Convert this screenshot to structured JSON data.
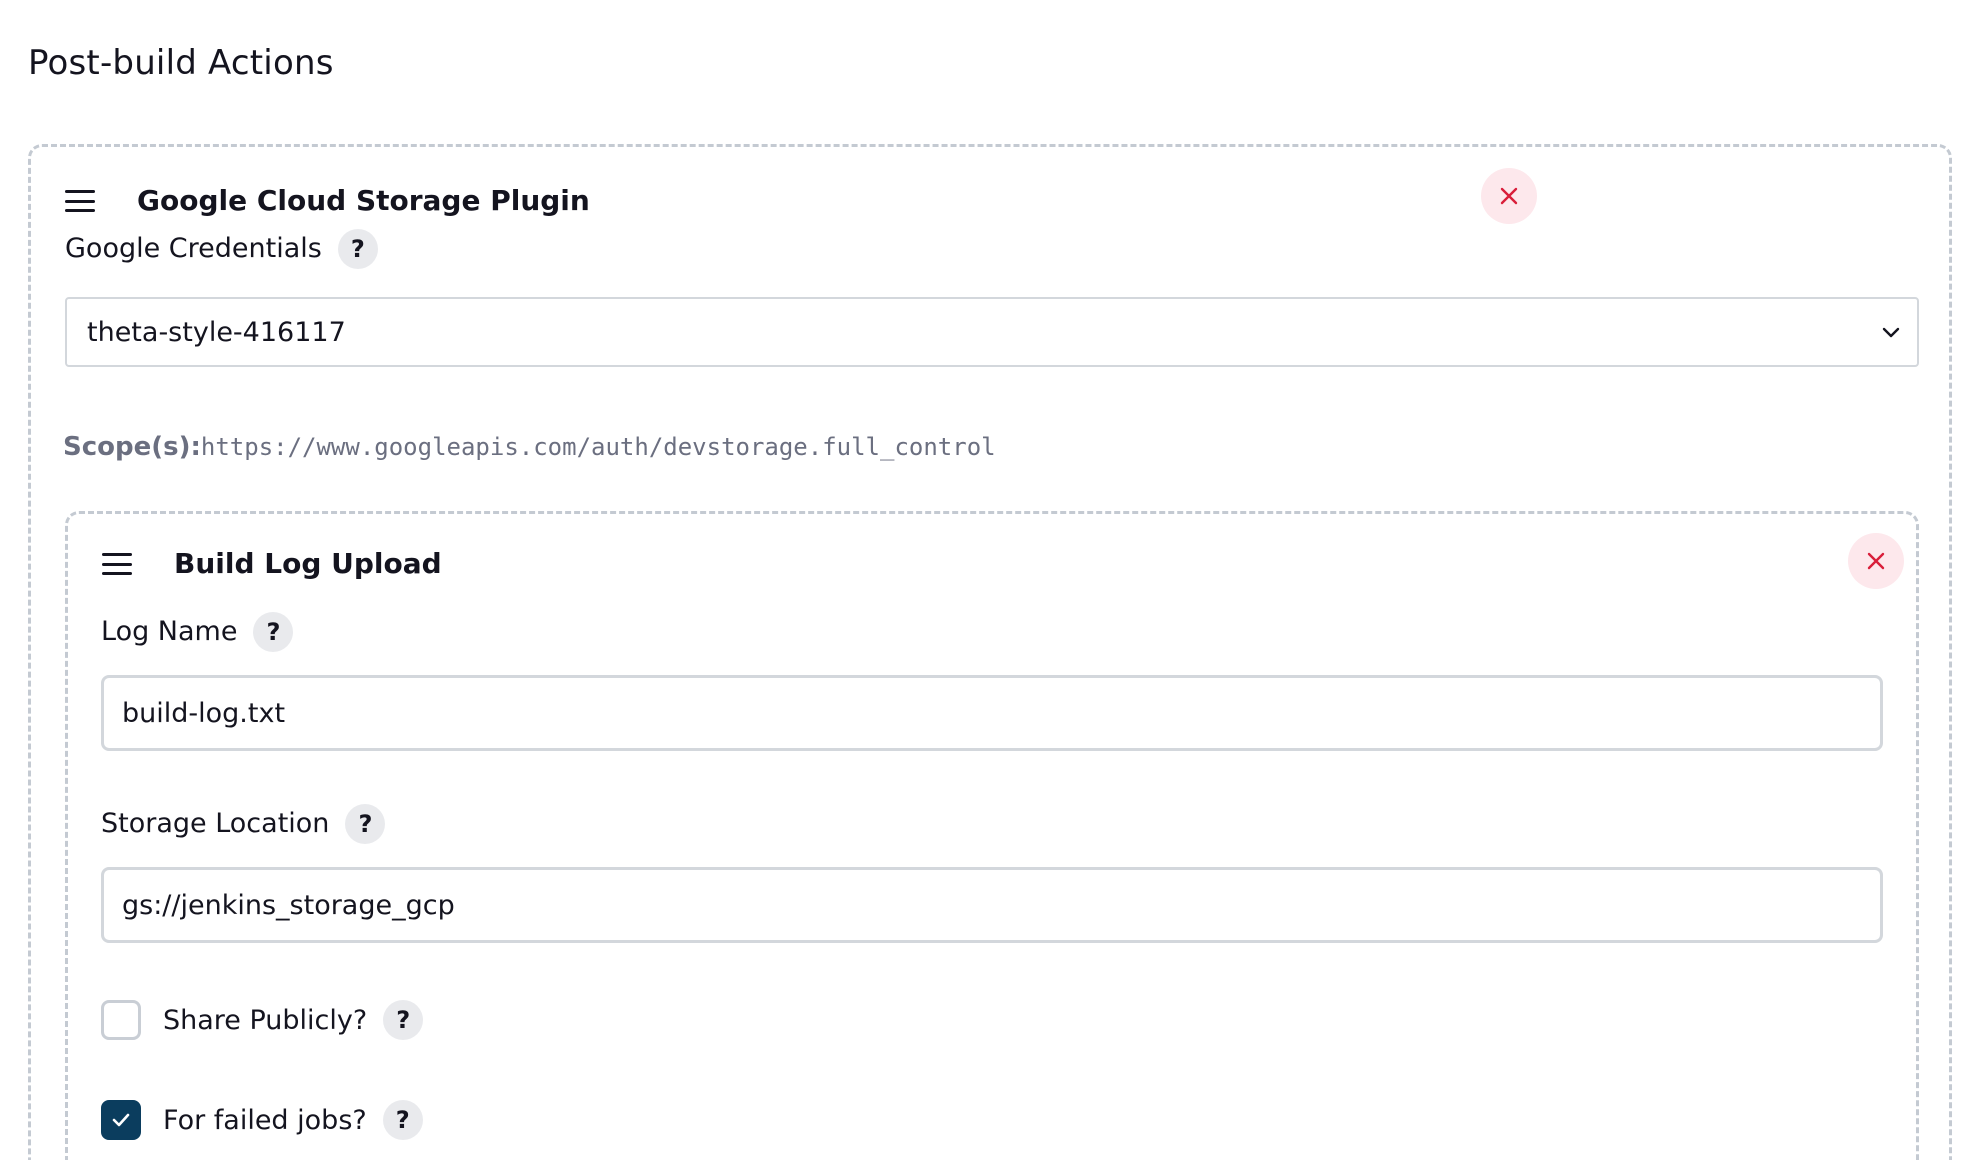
{
  "section": {
    "title": "Post-build Actions"
  },
  "plugin": {
    "title": "Google Cloud Storage Plugin",
    "credentials": {
      "label": "Google Credentials",
      "help": "?",
      "selected": "theta-style-416117"
    },
    "scope": {
      "label": "Scope(s):",
      "value": "https://www.googleapis.com/auth/devstorage.full_control"
    }
  },
  "upload": {
    "title": "Build Log Upload",
    "log_name": {
      "label": "Log Name",
      "help": "?",
      "value": "build-log.txt"
    },
    "storage_location": {
      "label": "Storage Location",
      "help": "?",
      "value": "gs://jenkins_storage_gcp"
    },
    "share_publicly": {
      "label": "Share Publicly?",
      "help": "?",
      "checked": false
    },
    "failed_jobs": {
      "label": "For failed jobs?",
      "help": "?",
      "checked": true
    }
  },
  "colors": {
    "dashed_border": "#c4cad2",
    "delete_bg": "#fde8ec",
    "delete_icon": "#d91e3a",
    "checkbox_checked": "#0b3d5e",
    "help_bg": "#e9eaed"
  }
}
